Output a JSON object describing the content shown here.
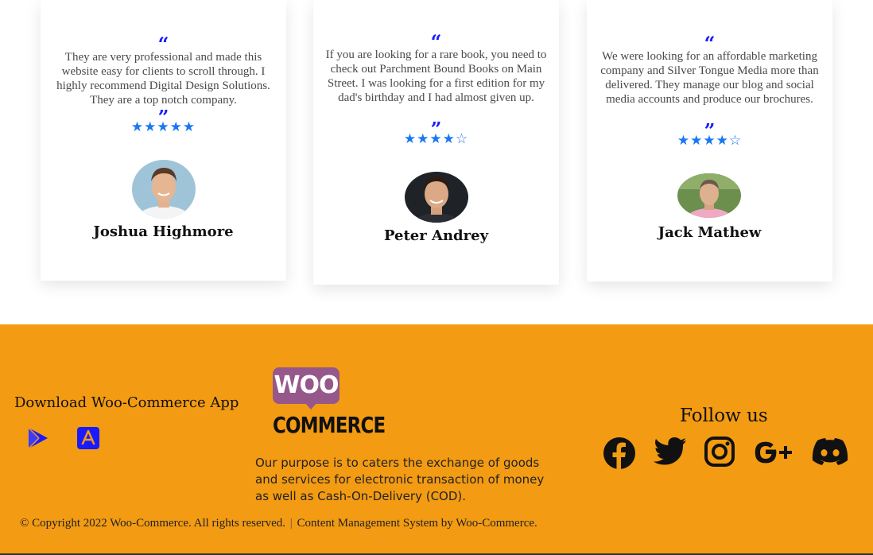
{
  "testimonials": [
    {
      "quote": "They are very professional and made this website easy for clients to scroll through. I highly recommend Digital Design Solutions. They are a top notch company.",
      "rating": 5,
      "stars": "★★★★★",
      "name": "Joshua Highmore"
    },
    {
      "quote": "If you are looking for a rare book, you need to check out Parchment Bound Books on Main Street. I was looking for a first edition for my dad's birthday and I had almost given up.",
      "rating": 4,
      "stars": "★★★★☆",
      "name": "Peter Andrey"
    },
    {
      "quote": "We were looking for an affordable marketing company and Silver Tongue Media more than delivered. They manage our blog and social media accounts and produce our brochures.",
      "rating": 4,
      "stars": "★★★★☆",
      "name": "Jack Mathew"
    }
  ],
  "quote_marks": {
    "open": "“",
    "close": "”"
  },
  "footer": {
    "download_title": "Download Woo-Commerce App",
    "stores": [
      "google-play-icon",
      "app-store-icon"
    ],
    "logo": {
      "bubble": "WOO",
      "wordmark": "COMMERCE"
    },
    "purpose": "Our purpose is to caters the exchange of goods and services for electronic transaction of money as well as Cash-On-Delivery (COD).",
    "follow_title": "Follow us",
    "socials": [
      "facebook-icon",
      "twitter-icon",
      "instagram-icon",
      "google-plus-icon",
      "discord-icon"
    ],
    "copyright": "© Copyright 2022 Woo-Commerce. All rights reserved.",
    "separator": "|",
    "cms_credit": "Content Management System by Woo-Commerce."
  },
  "colors": {
    "footer_bg": "#f39b12",
    "star": "#1877f2",
    "quote_mark": "#1a1aff",
    "woo_purple": "#96588a"
  }
}
